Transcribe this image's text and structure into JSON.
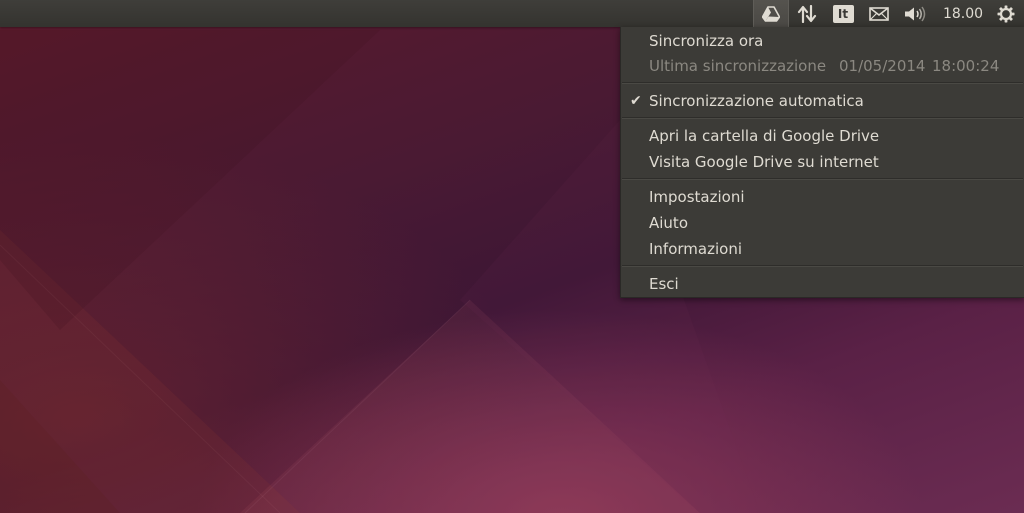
{
  "panel": {
    "clock": "18.00",
    "keyboard_layout": "It",
    "indicators": [
      "google-drive-icon",
      "network-transfer-icon",
      "keyboard-layout-indicator",
      "mail-icon",
      "volume-icon",
      "power-gear-icon"
    ]
  },
  "menu": {
    "sync_now": "Sincronizza ora",
    "last_sync_label": "Ultima sincronizzazione",
    "last_sync_date": "01/05/2014",
    "last_sync_time": "18:00:24",
    "auto_sync": "Sincronizzazione automatica",
    "auto_sync_checked": true,
    "open_folder": "Apri la cartella di Google Drive",
    "visit_online": "Visita Google Drive su internet",
    "settings": "Impostazioni",
    "help": "Aiuto",
    "about": "Informazioni",
    "quit": "Esci"
  },
  "colors": {
    "panel": "#3c3b37",
    "menu_bg": "#3c3b37",
    "menu_text": "#dfdbd2",
    "disabled_text": "#8b8881",
    "wallpaper_dark": "#3d1635",
    "wallpaper_accent": "#8a3a5a"
  }
}
